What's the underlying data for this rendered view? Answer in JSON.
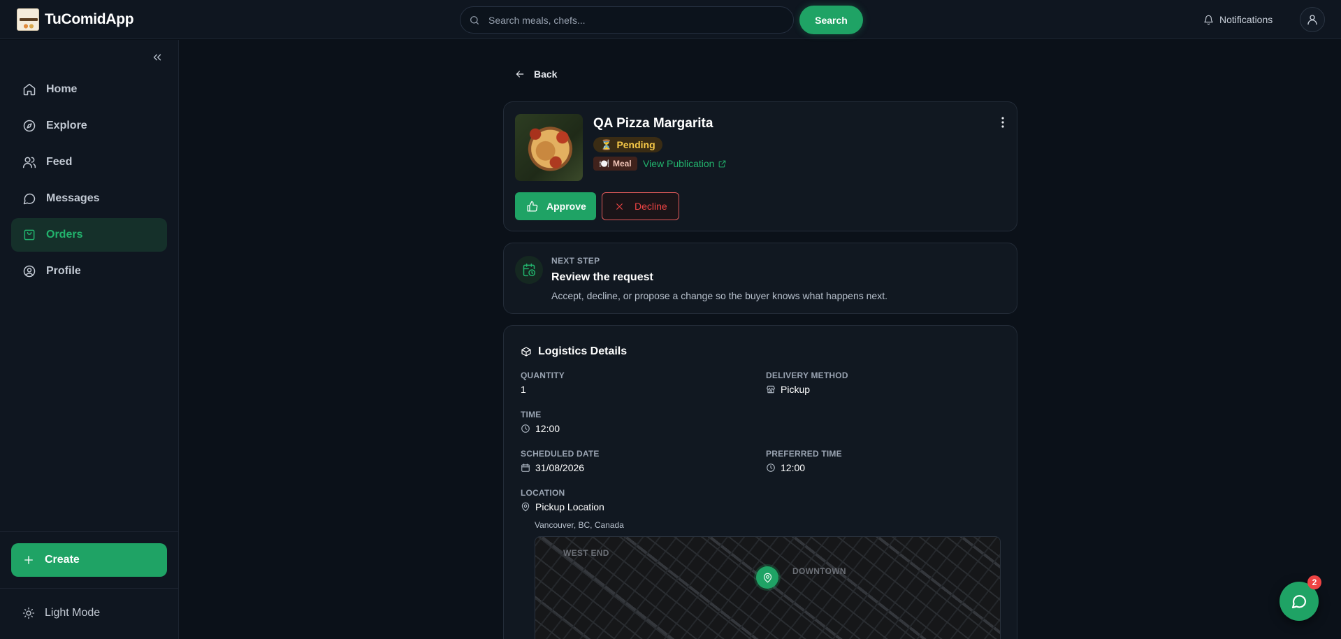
{
  "app": {
    "name": "TuComidApp",
    "logo_text": "TuComidApp"
  },
  "search": {
    "placeholder": "Search meals, chefs...",
    "value": "",
    "button_label": "Search"
  },
  "header": {
    "notifications_label": "Notifications"
  },
  "sidebar": {
    "items": [
      {
        "label": "Home",
        "icon": "home-icon",
        "active": false
      },
      {
        "label": "Explore",
        "icon": "compass-icon",
        "active": false
      },
      {
        "label": "Feed",
        "icon": "users-icon",
        "active": false
      },
      {
        "label": "Messages",
        "icon": "chat-bubble-icon",
        "active": false
      },
      {
        "label": "Orders",
        "icon": "shopping-bag-icon",
        "active": true
      },
      {
        "label": "Profile",
        "icon": "user-circle-icon",
        "active": false
      }
    ],
    "create_label": "Create",
    "mode_label": "Light Mode"
  },
  "back_label": "Back",
  "order": {
    "title": "QA Pizza Margarita",
    "status": "Pending",
    "status_emoji": "⏳",
    "type": "Meal",
    "type_emoji": "🍽️",
    "view_publication_label": "View Publication",
    "approve_label": "Approve",
    "decline_label": "Decline"
  },
  "next_step": {
    "label": "NEXT STEP",
    "title": "Review the request",
    "description": "Accept, decline, or propose a change so the buyer knows what happens next."
  },
  "logistics": {
    "title": "Logistics Details",
    "quantity_label": "QUANTITY",
    "quantity_value": "1",
    "delivery_label": "DELIVERY METHOD",
    "delivery_value": "Pickup",
    "time_label": "TIME",
    "time_value": "12:00",
    "date_label": "SCHEDULED DATE",
    "date_value": "31/08/2026",
    "preferred_label": "PREFERRED TIME",
    "preferred_value": "12:00",
    "location_label": "LOCATION",
    "location_value": "Pickup Location",
    "address": "Vancouver, BC, Canada",
    "map_labels": {
      "west_end": "WEST END",
      "downtown": "DOWNTOWN"
    }
  },
  "chat": {
    "unread_count": "2"
  },
  "colors": {
    "accent": "#1fa365",
    "pending": "#f7c948",
    "danger": "#ef4444",
    "background": "#0b1119"
  }
}
